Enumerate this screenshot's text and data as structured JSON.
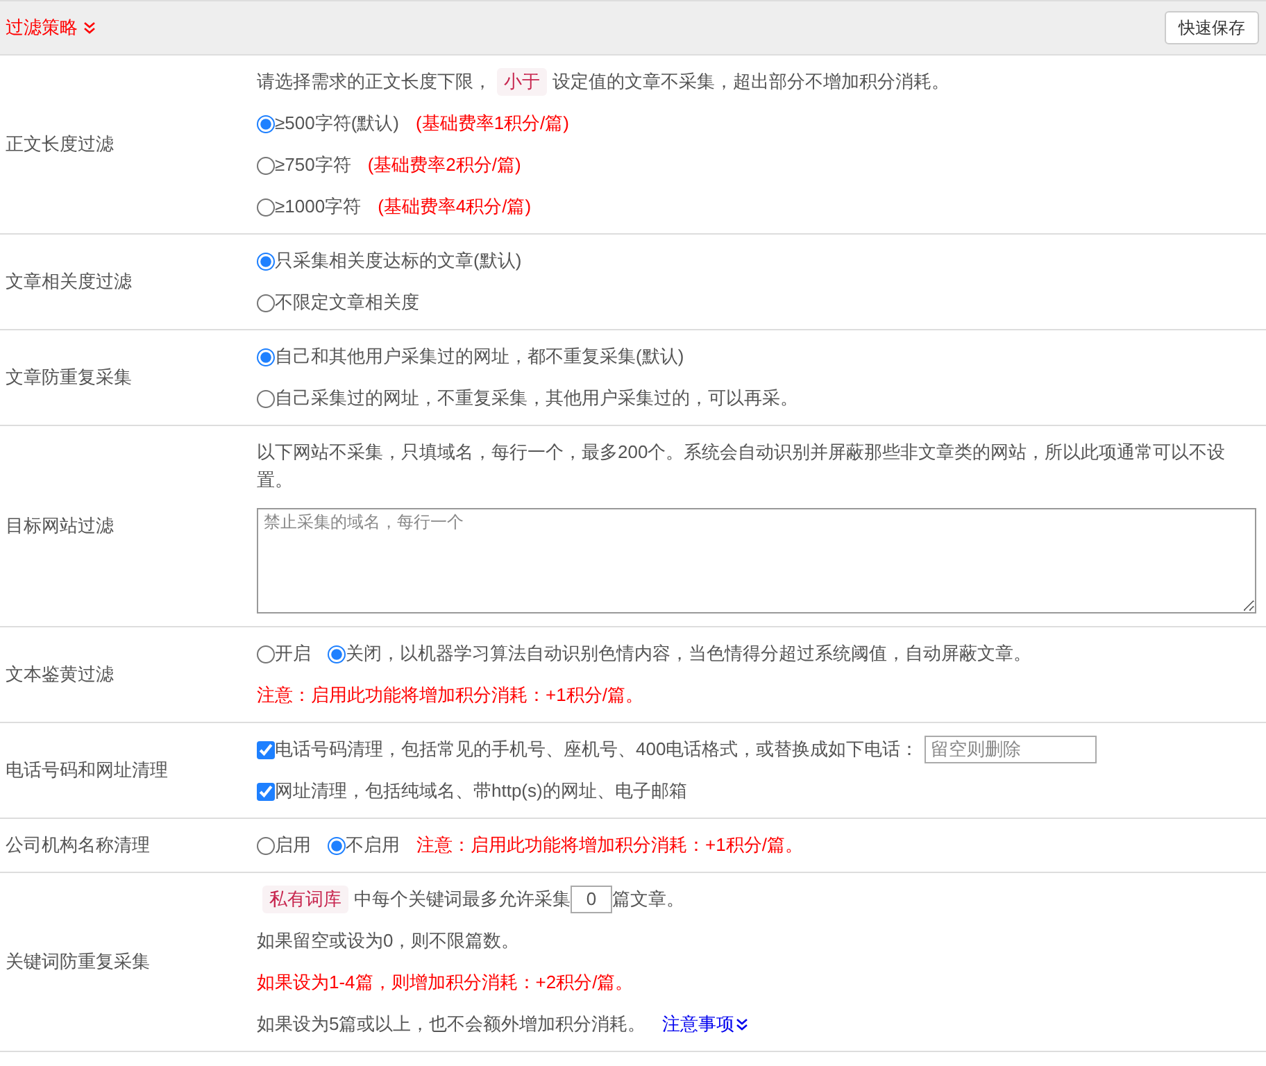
{
  "header": {
    "title": "过滤策略",
    "save_button": "快速保存"
  },
  "rows": [
    {
      "label": "正文长度过滤",
      "lines": [
        {
          "segments": [
            {
              "kind": "text",
              "text": "请选择需求的正文长度下限，"
            },
            {
              "kind": "tag",
              "text": "小于"
            },
            {
              "kind": "text",
              "text": "设定值的文章不采集，超出部分不增加积分消耗。"
            }
          ]
        },
        {
          "segments": [
            {
              "kind": "radio",
              "label": "≥500字符(默认)",
              "selected": true
            },
            {
              "kind": "red",
              "text": "(基础费率1积分/篇)"
            }
          ]
        },
        {
          "segments": [
            {
              "kind": "radio",
              "label": "≥750字符",
              "selected": false
            },
            {
              "kind": "red",
              "text": "(基础费率2积分/篇)"
            }
          ]
        },
        {
          "segments": [
            {
              "kind": "radio",
              "label": "≥1000字符",
              "selected": false
            },
            {
              "kind": "red",
              "text": "(基础费率4积分/篇)"
            }
          ]
        }
      ]
    },
    {
      "label": "文章相关度过滤",
      "lines": [
        {
          "segments": [
            {
              "kind": "radio",
              "label": "只采集相关度达标的文章(默认)",
              "selected": true
            }
          ]
        },
        {
          "segments": [
            {
              "kind": "radio",
              "label": "不限定文章相关度",
              "selected": false
            }
          ]
        }
      ]
    },
    {
      "label": "文章防重复采集",
      "lines": [
        {
          "segments": [
            {
              "kind": "radio",
              "label": "自己和其他用户采集过的网址，都不重复采集(默认)",
              "selected": true
            }
          ]
        },
        {
          "segments": [
            {
              "kind": "radio",
              "label": "自己采集过的网址，不重复采集，其他用户采集过的，可以再采。",
              "selected": false
            }
          ]
        }
      ]
    },
    {
      "label": "目标网站过滤",
      "lines": [
        {
          "segments": [
            {
              "kind": "text",
              "text": "以下网站不采集，只填域名，每行一个，最多200个。系统会自动识别并屏蔽那些非文章类的网站，所以此项通常可以不设置。"
            }
          ]
        },
        {
          "segments": [
            {
              "kind": "textarea",
              "placeholder": "禁止采集的域名，每行一个"
            }
          ]
        }
      ]
    },
    {
      "label": "文本鉴黄过滤",
      "lines": [
        {
          "segments": [
            {
              "kind": "radio",
              "label": "开启",
              "selected": false
            },
            {
              "kind": "radio",
              "label": "关闭，以机器学习算法自动识别色情内容，当色情得分超过系统阈值，自动屏蔽文章。",
              "selected": true
            }
          ]
        },
        {
          "segments": [
            {
              "kind": "red",
              "text": "注意：启用此功能将增加积分消耗：+1积分/篇。"
            }
          ]
        }
      ]
    },
    {
      "label": "电话号码和网址清理",
      "lines": [
        {
          "segments": [
            {
              "kind": "checkbox",
              "label": "电话号码清理，包括常见的手机号、座机号、400电话格式，或替换成如下电话：",
              "checked": true
            },
            {
              "kind": "input",
              "placeholder": "留空则删除"
            }
          ]
        },
        {
          "segments": [
            {
              "kind": "checkbox",
              "label": "网址清理，包括纯域名、带http(s)的网址、电子邮箱",
              "checked": true
            }
          ]
        }
      ]
    },
    {
      "label": "公司机构名称清理",
      "lines": [
        {
          "segments": [
            {
              "kind": "radio",
              "label": "启用",
              "selected": false
            },
            {
              "kind": "radio",
              "label": "不启用",
              "selected": true
            },
            {
              "kind": "red",
              "text": "注意：启用此功能将增加积分消耗：+1积分/篇。"
            }
          ]
        }
      ]
    },
    {
      "label": "关键词防重复采集",
      "lines": [
        {
          "segments": [
            {
              "kind": "tag",
              "text": "私有词库"
            },
            {
              "kind": "text",
              "text": "中每个关键词最多允许采集"
            },
            {
              "kind": "number",
              "value": "0"
            },
            {
              "kind": "text",
              "text": "篇文章。"
            }
          ]
        },
        {
          "segments": [
            {
              "kind": "text",
              "text": "如果留空或设为0，则不限篇数。"
            }
          ]
        },
        {
          "segments": [
            {
              "kind": "red",
              "text": "如果设为1-4篇，则增加积分消耗：+2积分/篇。"
            }
          ]
        },
        {
          "segments": [
            {
              "kind": "text",
              "text": "如果设为5篇或以上，也不会额外增加积分消耗。"
            },
            {
              "kind": "link",
              "text": "注意事项"
            }
          ]
        }
      ]
    }
  ]
}
